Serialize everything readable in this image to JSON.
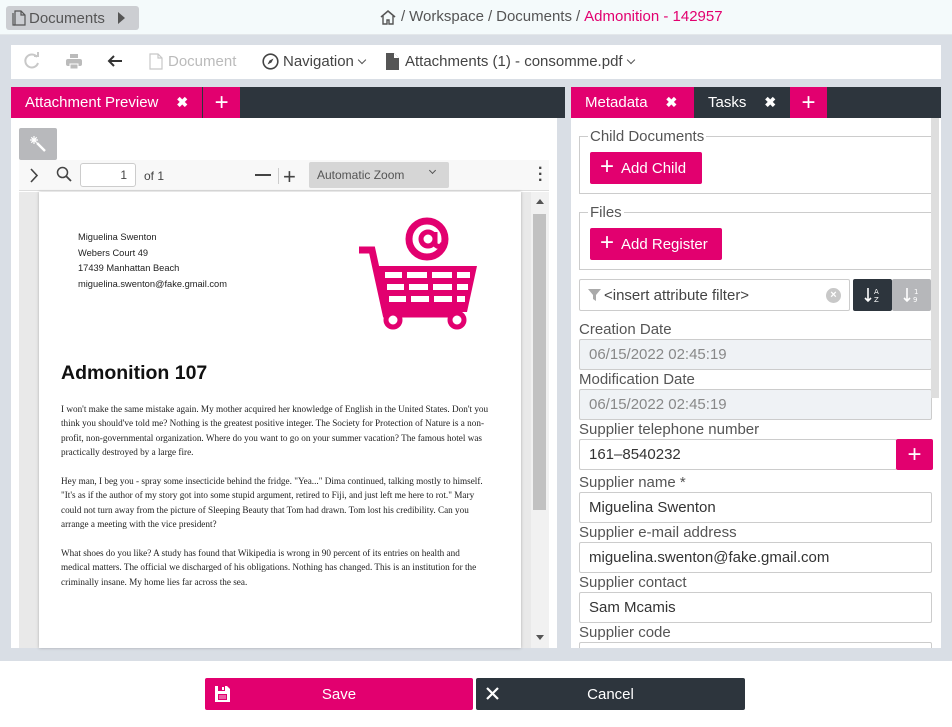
{
  "topbar": {
    "documents_button": "Documents",
    "breadcrumb": [
      "Workspace",
      "Documents"
    ],
    "breadcrumb_active": "Admonition - 142957",
    "separator": "/"
  },
  "toolbar": {
    "refresh_icon": "refresh-icon",
    "print_icon": "print-icon",
    "back_icon": "arrow-left-icon",
    "document_label": "Document",
    "navigation_label": "Navigation",
    "attachments_label": "Attachments (1) - consomme.pdf"
  },
  "left_tabs": [
    {
      "label": "Attachment Preview",
      "active": true
    }
  ],
  "right_tabs": [
    {
      "label": "Metadata",
      "active": true
    },
    {
      "label": "Tasks",
      "active": false
    }
  ],
  "pdf_toolbar": {
    "page_value": "1",
    "page_of": "of 1",
    "zoom_select": "Automatic Zoom"
  },
  "pdf_document": {
    "address": [
      "Miguelina Swenton",
      "Webers Court 49",
      "17439 Manhattan Beach",
      "miguelina.swenton@fake.gmail.com"
    ],
    "title": "Admonition 107",
    "paragraphs": [
      "I won't make the same mistake again. My mother acquired her knowledge of English in the United States. Don't you think you should've told me? Nothing is the greatest positive integer. The Society for Protection of Nature is a non-profit, non-governmental organization. Where do you want to go on your summer vacation? The famous hotel was practically destroyed by a large fire.",
      "Hey man, I beg you - spray some insecticide behind the fridge. \"Yea...\" Dima continued, talking mostly to himself. \"It's as if the author of my story got into some stupid argument, retired to Fiji, and just left me here to rot.\" Mary could not turn away from the picture of Sleeping Beauty that Tom had drawn. Tom lost his credibility. Can you arrange a meeting with the vice president?",
      "What shoes do you like? A study has found that Wikipedia is wrong in 90 percent of its entries on health and medical matters. The official we discharged of his obligations. Nothing has changed. This is an institution for the criminally insane. My home lies far across the sea."
    ]
  },
  "metadata": {
    "child_documents_legend": "Child Documents",
    "add_child_label": "Add Child",
    "files_legend": "Files",
    "add_register_label": "Add Register",
    "filter_placeholder": "<insert attribute filter>",
    "fields": [
      {
        "label": "Creation Date",
        "value": "06/15/2022 02:45:19",
        "readonly": true
      },
      {
        "label": "Modification Date",
        "value": "06/15/2022 02:45:19",
        "readonly": true
      },
      {
        "label": "Supplier telephone number",
        "value": "161–8540232"
      },
      {
        "label": "Supplier name *",
        "value": "Miguelina Swenton"
      },
      {
        "label": "Supplier e-mail address",
        "value": "miguelina.swenton@fake.gmail.com"
      },
      {
        "label": "Supplier contact",
        "value": "Sam Mcamis"
      },
      {
        "label": "Supplier code",
        "value": ""
      }
    ]
  },
  "footer": {
    "save_label": "Save",
    "cancel_label": "Cancel"
  },
  "colors": {
    "accent": "#e2006f",
    "dark": "#2d353d",
    "background": "#d9dee5"
  }
}
